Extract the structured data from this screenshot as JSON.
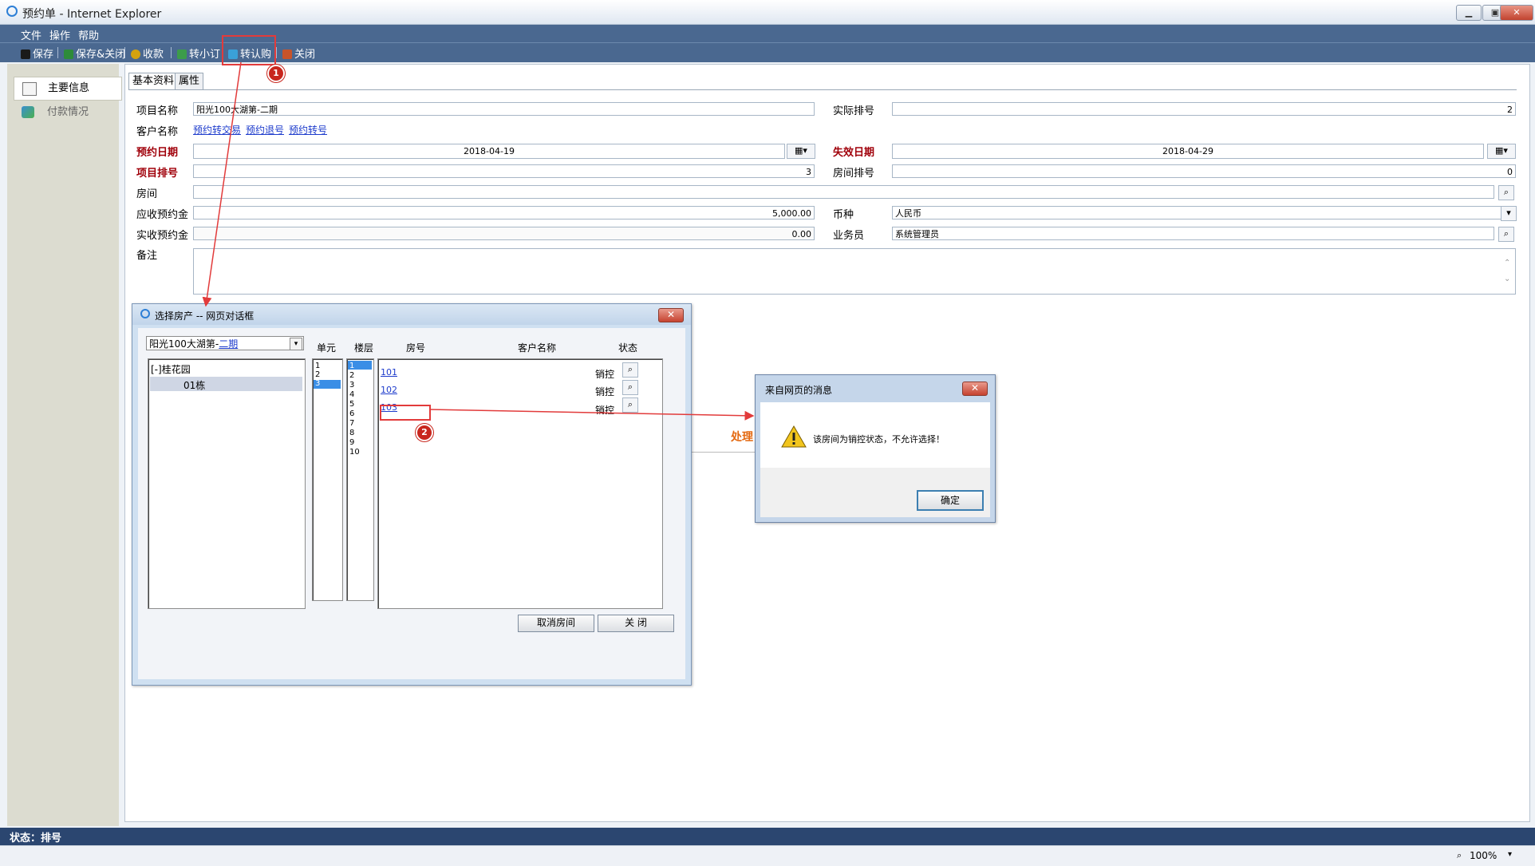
{
  "window": {
    "title": "预约单 - Internet Explorer"
  },
  "menu": [
    "文件",
    "操作",
    "帮助"
  ],
  "toolbar": {
    "save": "保存",
    "save_close": "保存&关闭",
    "receive": "收款",
    "to_small": "转小订",
    "to_confirm": "转认购",
    "close": "关闭"
  },
  "leftnav": {
    "main_info": "主要信息",
    "payment": "付款情况"
  },
  "tabs": {
    "basic": "基本资料",
    "attr": "属性"
  },
  "form": {
    "project_name_label": "项目名称",
    "project_name": "阳光100大湖第-二期",
    "actual_rank_label": "实际排号",
    "actual_rank": "2",
    "customer_label": "客户名称",
    "links": {
      "to_trade": "预约转交易",
      "retire": "预约退号",
      "transfer": "预约转号"
    },
    "reserve_date_label": "预约日期",
    "reserve_date": "2018-04-19",
    "expire_date_label": "失效日期",
    "expire_date": "2018-04-29",
    "project_rank_label": "项目排号",
    "project_rank": "3",
    "room_rank_label": "房间排号",
    "room_rank": "0",
    "room_label": "房间",
    "room": "",
    "due_deposit_label": "应收预约金",
    "due_deposit": "5,000.00",
    "currency_label": "币种",
    "currency": "人民币",
    "paid_deposit_label": "实收预约金",
    "paid_deposit": "0.00",
    "salesman_label": "业务员",
    "salesman": "系统管理员",
    "remark_label": "备注",
    "remark": ""
  },
  "dialog_select": {
    "title": "选择房产 -- 网页对话框",
    "project_select_prefix": "阳光100大湖第-",
    "project_select_link": "二期",
    "col_unit": "单元",
    "col_floor": "楼层",
    "col_room": "房号",
    "col_customer": "客户名称",
    "col_status": "状态",
    "tree_root": "[-]桂花园",
    "tree_child": "01栋",
    "units": [
      "1",
      "2",
      "3"
    ],
    "floors": [
      "1",
      "2",
      "3",
      "4",
      "5",
      "6",
      "7",
      "8",
      "9",
      "10"
    ],
    "rooms": [
      {
        "no": "101",
        "status": "销控"
      },
      {
        "no": "102",
        "status": "销控"
      },
      {
        "no": "103",
        "status": "销控"
      }
    ],
    "cancel_room": "取消房间",
    "close": "关 闭"
  },
  "dialog_msg": {
    "title": "来自网页的消息",
    "message": "该房间为销控状态，不允许选择！",
    "ok": "确定"
  },
  "bg_process_label": "处理",
  "status": "状态：排号",
  "zoom": "100%",
  "annotations": [
    "1",
    "2"
  ],
  "colors": {
    "accent": "#4a6890",
    "required": "#a0000a",
    "annotation": "#e23b3b"
  }
}
